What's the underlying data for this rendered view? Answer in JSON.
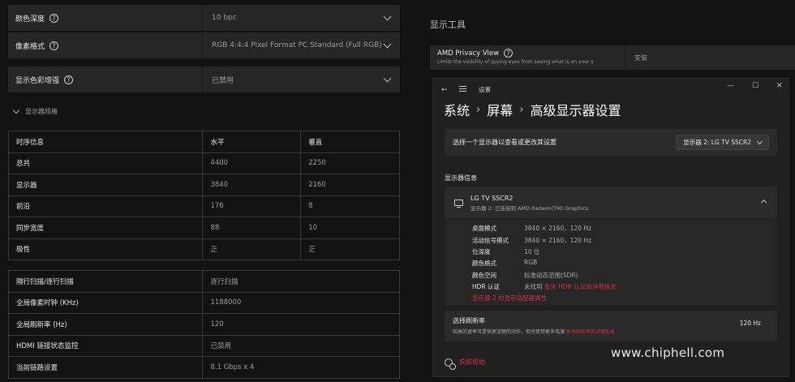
{
  "left": {
    "rows": [
      {
        "label": "颜色深度",
        "value": "10 bpc"
      },
      {
        "label": "像素格式",
        "value": "RGB 4:4:4 Pixel Format PC Standard (Full RGB)"
      },
      {
        "label": "显示色彩增强",
        "value": "已禁用"
      }
    ],
    "section_label": "显示器规格",
    "timing_table": {
      "headers": [
        "时序信息",
        "水平",
        "垂直"
      ],
      "rows": [
        [
          "总共",
          "4400",
          "2250"
        ],
        [
          "显示器",
          "3840",
          "2160"
        ],
        [
          "前沿",
          "176",
          "8"
        ],
        [
          "同步宽度",
          "88",
          "10"
        ],
        [
          "极性",
          "正",
          "正"
        ]
      ]
    },
    "info_table": [
      [
        "隔行扫描/逐行扫描",
        "逐行扫描"
      ],
      [
        "全局像素时钟 (KHz)",
        "1188000"
      ],
      [
        "全局刷新率 (Hz)",
        "120"
      ],
      [
        "HDMI 链接状态监控",
        "已禁用"
      ],
      [
        "当前链路设置",
        "8.1 Gbps x 4"
      ]
    ]
  },
  "right": {
    "tools_title": "显示工具",
    "privacy": {
      "title": "AMD Privacy View",
      "desc": "Limits the visibility of spying eyes from seeing what is on your s",
      "action": "安装"
    }
  },
  "settings": {
    "window_title": "设置",
    "back_glyph": "←",
    "min_glyph": "—",
    "max_glyph": "☐",
    "close_glyph": "✕",
    "breadcrumb": [
      "系统",
      "屏幕",
      "高级显示器设置"
    ],
    "breadcrumb_sep": "›",
    "select_prompt": "选择一个显示器以查看或更改其设置",
    "selected_display": "显示器 2: LG TV SSCR2",
    "info_header": "显示器信息",
    "monitor_name": "LG TV SSCR2",
    "monitor_sub": "显示器 2: 已连接到 AMD Radeon(TM) Graphics",
    "specs": [
      {
        "k": "桌面模式",
        "v": "3840 × 2160，120 Hz"
      },
      {
        "k": "活动信号模式",
        "v": "3840 × 2160，120 Hz"
      },
      {
        "k": "位深度",
        "v": "10 位"
      },
      {
        "k": "颜色格式",
        "v": "RGB"
      },
      {
        "k": "颜色空间",
        "v": "标准动态范围(SDR)"
      },
      {
        "k": "HDR 认证",
        "v": "未找到"
      }
    ],
    "hdr_link": "有关 HDR 认证的详细信息",
    "adapter_link": "显示器 2 的显示适配器属性",
    "refresh_title": "选择刷新率",
    "refresh_desc": "较高的速率可提供更流畅的动作，但也使用更多电源",
    "refresh_link": "有关刷新率的详细信息",
    "refresh_value": "120 Hz",
    "help": "获取帮助"
  },
  "watermark": "www.chiphell.com",
  "colors": {
    "link_red": "#d1303e",
    "panel": "#262626",
    "bg": "#121212"
  }
}
